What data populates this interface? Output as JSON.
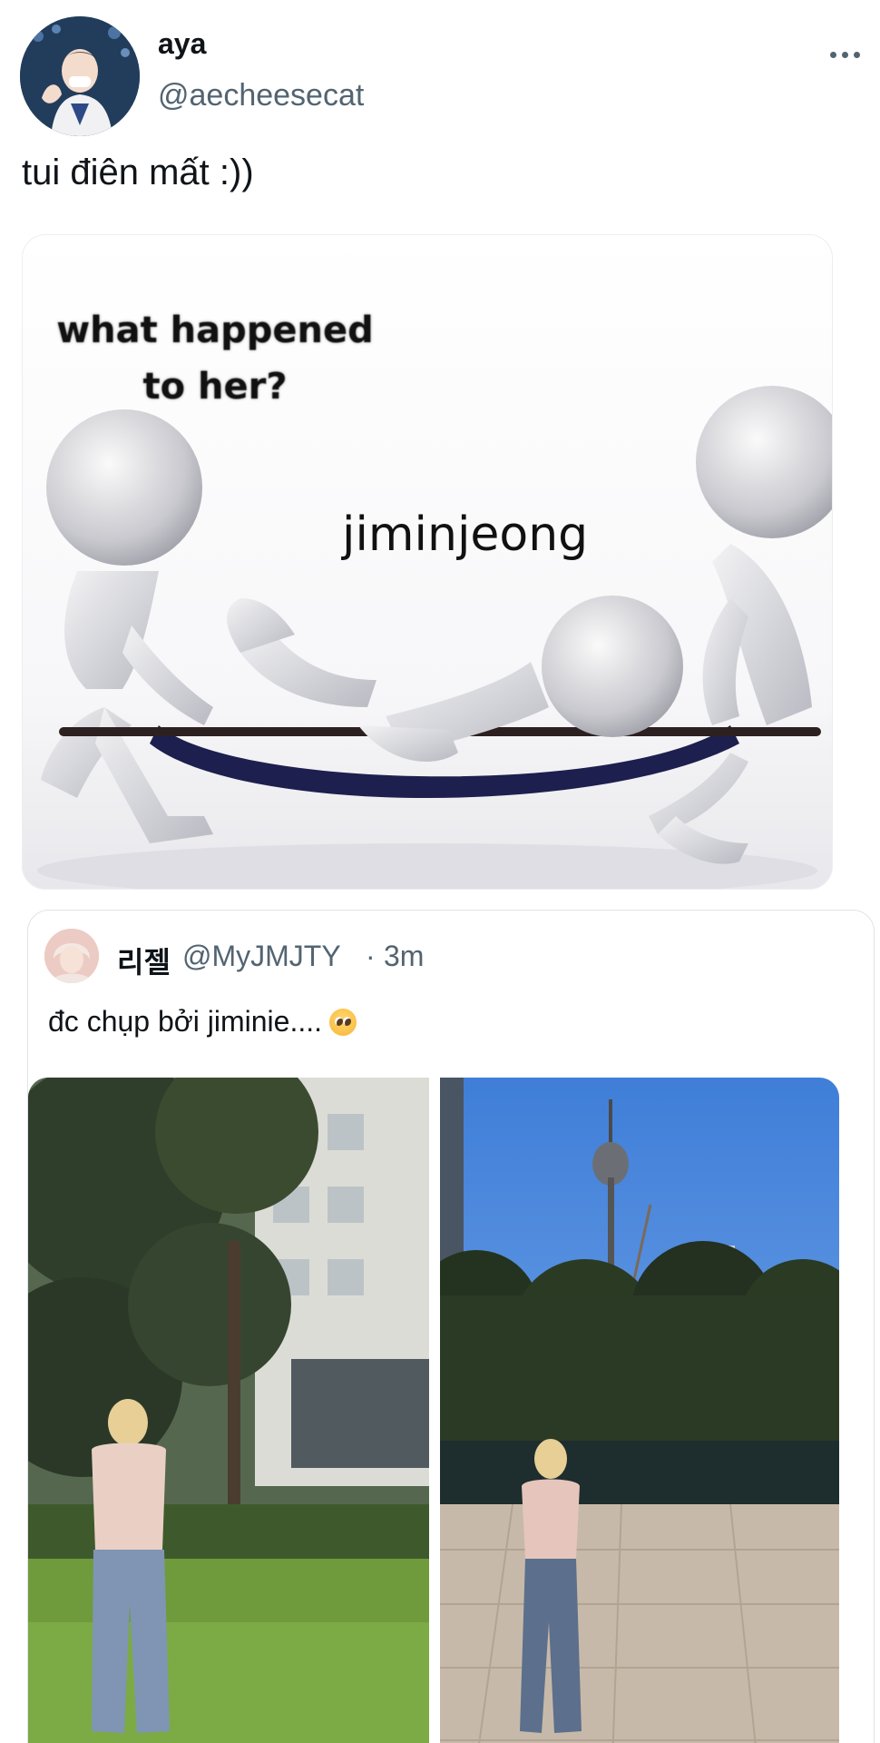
{
  "tweet": {
    "display_name": "aya",
    "handle": "@aecheesecat",
    "text": "tui điên mất :))",
    "more_icon": "more-horizontal-icon",
    "image": {
      "caption": "what happened to her?",
      "caption_line1": "what happened",
      "caption_line2": "to  her?",
      "label": "jiminjeong"
    }
  },
  "quote": {
    "display_name": "리젤",
    "handle": "@MyJMJTY",
    "separator": "·",
    "time": "3m",
    "text": "đc chụp bởi jiminie....",
    "emoji": "pleading-face-emoji",
    "photos": [
      "park-photo",
      "city-tower-photo"
    ]
  },
  "colors": {
    "text_primary": "#0f1419",
    "text_secondary": "#536471",
    "border": "#dfe3e7"
  }
}
